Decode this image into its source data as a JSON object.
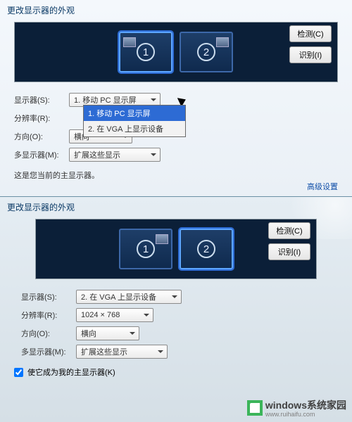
{
  "top": {
    "title": "更改显示器的外观",
    "monitors": [
      "1",
      "2"
    ],
    "buttons": {
      "detect": "检测(C)",
      "identify": "识别(I)"
    },
    "form": {
      "display_label": "显示器(S):",
      "display_value": "1. 移动 PC 显示屏",
      "display_options": [
        "1. 移动 PC 显示屏",
        "2. 在 VGA 上显示设备"
      ],
      "resolution_label": "分辨率(R):",
      "orientation_label": "方向(O):",
      "orientation_value": "横向",
      "multi_label": "多显示器(M):",
      "multi_value": "扩展这些显示"
    },
    "note": "这是您当前的主显示器。",
    "advanced": "高级设置"
  },
  "bottom": {
    "title": "更改显示器的外观",
    "monitors": [
      "1",
      "2"
    ],
    "buttons": {
      "detect": "检测(C)",
      "identify": "识别(I)"
    },
    "form": {
      "display_label": "显示器(S):",
      "display_value": "2. 在 VGA 上显示设备",
      "resolution_label": "分辨率(R):",
      "resolution_value": "1024 × 768",
      "orientation_label": "方向(O):",
      "orientation_value": "横向",
      "multi_label": "多显示器(M):",
      "multi_value": "扩展这些显示"
    },
    "checkbox_label": "使它成为我的主显示器(K)",
    "checkbox_checked": true
  },
  "watermark": {
    "brand": "windows",
    "sub": "www.ruihaifu.com",
    "suffix": "系统家园"
  }
}
